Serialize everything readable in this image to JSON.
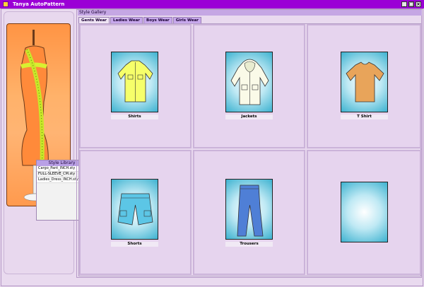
{
  "window": {
    "title": "Tanya AutoPattern"
  },
  "style_library": {
    "title": "Style Library",
    "items": [
      "Cargo_Pant_INCH.sty",
      "FULL-SLEEVE_CM.sty",
      "Ladies_Dress_INCH.sty"
    ]
  },
  "gallery": {
    "title": "Style Gallery",
    "tabs": [
      "Gents Wear",
      "Ladies Wear",
      "Boys Wear",
      "Girls Wear"
    ],
    "items": [
      {
        "label": "Shirts",
        "icon": "shirt-icon"
      },
      {
        "label": "Jackets",
        "icon": "jacket-icon"
      },
      {
        "label": "T Shirt",
        "icon": "tshirt-icon"
      },
      {
        "label": "Shorts",
        "icon": "shorts-icon"
      },
      {
        "label": "Trousers",
        "icon": "trousers-icon"
      },
      {
        "label": "",
        "icon": "empty-thumbnail"
      }
    ]
  },
  "colors": {
    "title_bar": "#9b00d6",
    "tab_active": "#efe4f4",
    "tab_inactive": "#c7a8ec"
  }
}
